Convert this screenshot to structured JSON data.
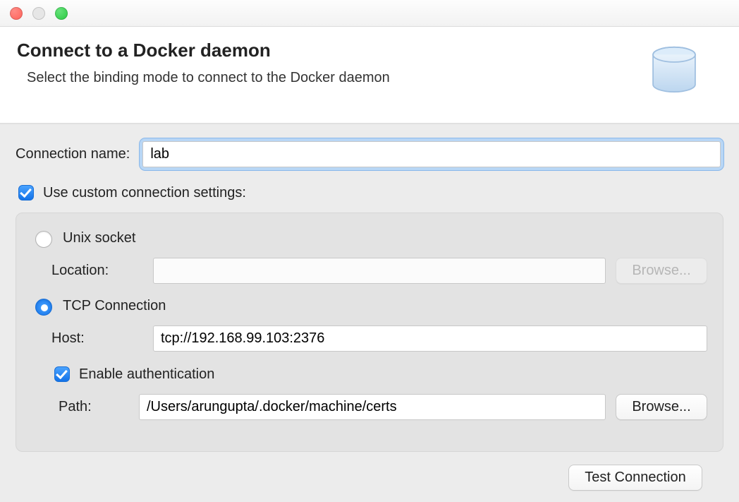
{
  "header": {
    "title": "Connect to a Docker daemon",
    "subtitle": "Select the binding mode to connect to the Docker daemon"
  },
  "form": {
    "connection_name_label": "Connection name:",
    "connection_name_value": "lab",
    "use_custom_label": "Use custom connection settings:",
    "use_custom_checked": true,
    "unix": {
      "radio_label": "Unix socket",
      "selected": false,
      "location_label": "Location:",
      "location_value": "",
      "browse_label": "Browse..."
    },
    "tcp": {
      "radio_label": "TCP Connection",
      "selected": true,
      "host_label": "Host:",
      "host_value": "tcp://192.168.99.103:2376",
      "auth_label": "Enable authentication",
      "auth_checked": true,
      "path_label": "Path:",
      "path_value": "/Users/arungupta/.docker/machine/certs",
      "browse_label": "Browse..."
    }
  },
  "footer": {
    "test_connection_label": "Test Connection"
  }
}
